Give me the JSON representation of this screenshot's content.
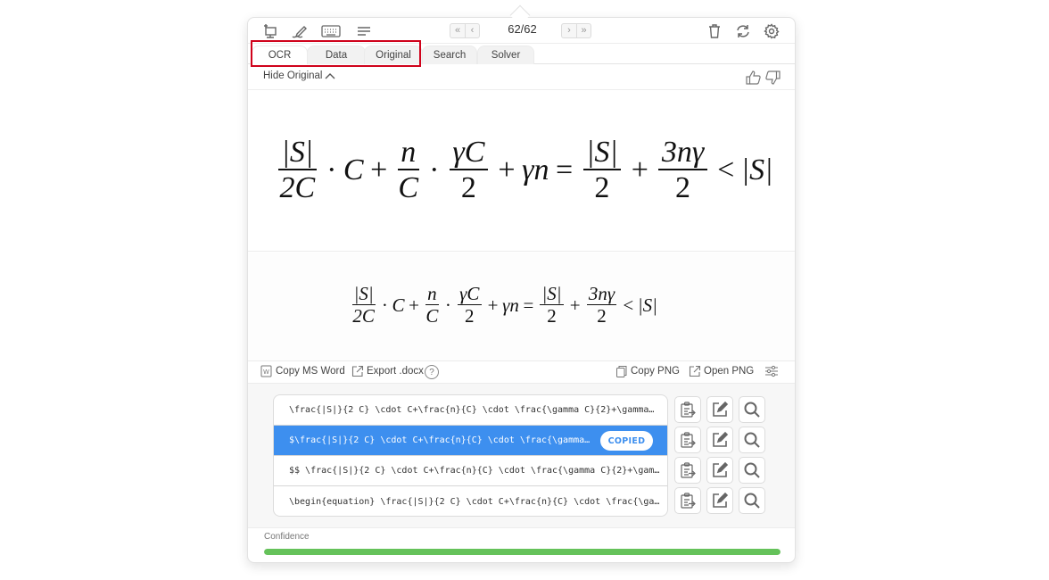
{
  "toolbar": {
    "icons": [
      "screen-capture-icon",
      "handwriting-icon",
      "keyboard-icon",
      "text-lines-icon"
    ],
    "nav": {
      "first": "«",
      "prev": "‹",
      "next": "›",
      "last": "»"
    },
    "counter": "62/62",
    "right_icons": [
      "trash-icon",
      "refresh-icon",
      "gear-icon"
    ]
  },
  "tabs": [
    {
      "label": "OCR",
      "active": true
    },
    {
      "label": "Data",
      "active": false
    },
    {
      "label": "Original",
      "active": false
    },
    {
      "label": "Search",
      "active": false
    },
    {
      "label": "Solver",
      "active": false
    }
  ],
  "hide_original": "Hide Original",
  "equation": {
    "t1_num": "|S|",
    "t1_den": "2C",
    "dot": "·",
    "C": "C",
    "plus": "+",
    "t2_num": "n",
    "t2_den": "C",
    "t3_num": "γC",
    "t3_den": "2",
    "gn": "γn",
    "eq": "=",
    "t4_num": "|S|",
    "t4_den": "2",
    "t5_num": "3nγ",
    "t5_den": "2",
    "lt": "<",
    "rhs": "|S|"
  },
  "actions": {
    "copy_ms_word": "Copy MS Word",
    "export_docx": "Export .docx",
    "help": "?",
    "copy_png": "Copy PNG",
    "open_png": "Open PNG"
  },
  "results": [
    {
      "text": "\\frac{|S|}{2 C} \\cdot C+\\frac{n}{C} \\cdot \\frac{\\gamma C}{2}+\\gamma…",
      "selected": false
    },
    {
      "text": "$\\frac{|S|}{2 C} \\cdot C+\\frac{n}{C} \\cdot \\frac{\\gamma…",
      "selected": true,
      "badge": "COPIED"
    },
    {
      "text": "$$ \\frac{|S|}{2 C} \\cdot C+\\frac{n}{C} \\cdot \\frac{\\gamma C}{2}+\\gam…",
      "selected": false
    },
    {
      "text": "\\begin{equation} \\frac{|S|}{2 C} \\cdot C+\\frac{n}{C} \\cdot \\frac{\\ga…",
      "selected": false
    }
  ],
  "confidence": {
    "label": "Confidence",
    "value": 1.0,
    "color": "#65c25a"
  },
  "colors": {
    "accent": "#3d8fef",
    "highlight_box": "#d0021b"
  }
}
